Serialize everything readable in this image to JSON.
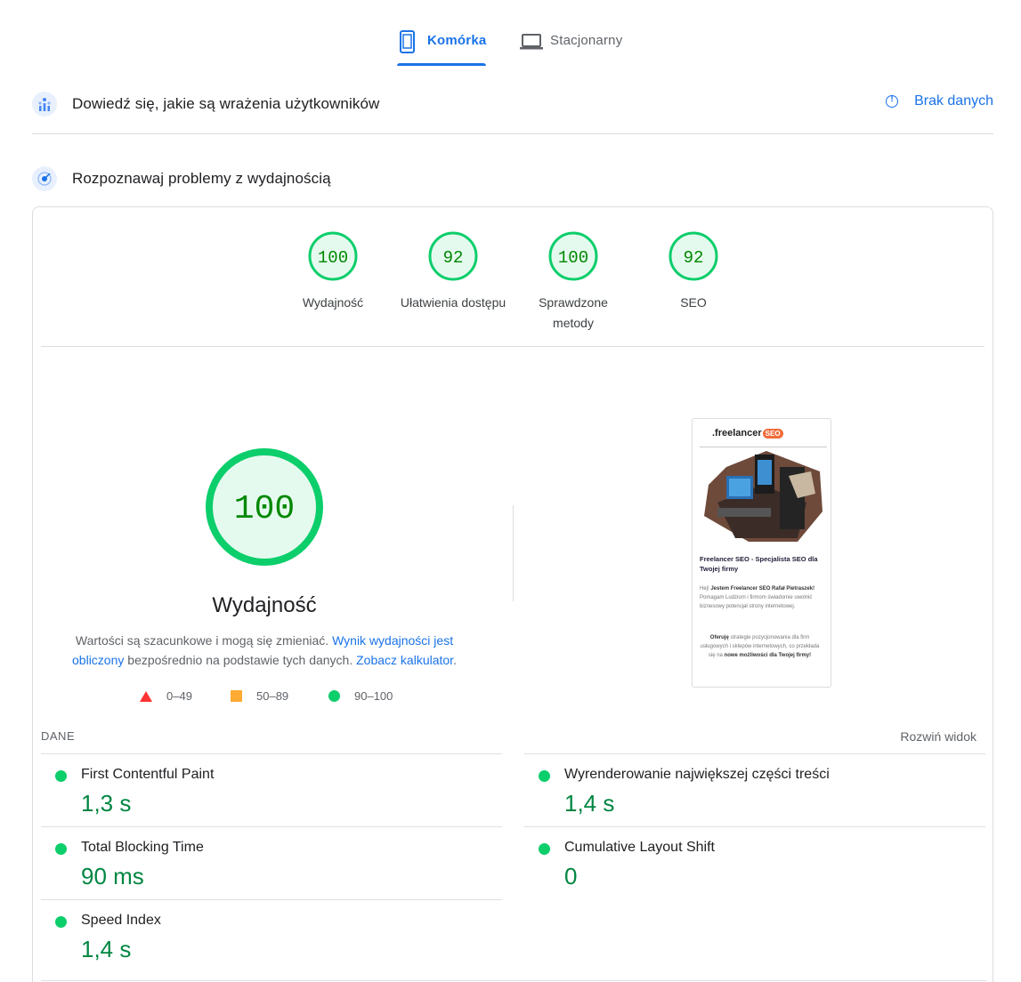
{
  "tabs": [
    {
      "label": "Komórka",
      "icon": "smartphone-icon",
      "active": true
    },
    {
      "label": "Stacjonarny",
      "icon": "laptop-icon",
      "active": false
    }
  ],
  "crux": {
    "title": "Dowiedź się, jakie są wrażenia użytkowników",
    "no_data_label": "Brak danych"
  },
  "lighthouse": {
    "title": "Rozpoznawaj problemy z wydajnością"
  },
  "gauges": [
    {
      "score": "100",
      "label_line1": "Wydajność",
      "label_line2": ""
    },
    {
      "score": "92",
      "label_line1": "Ułatwienia dostępu",
      "label_line2": ""
    },
    {
      "score": "100",
      "label_line1": "Sprawdzone",
      "label_line2": "metody"
    },
    {
      "score": "92",
      "label_line1": "SEO",
      "label_line2": ""
    }
  ],
  "performance": {
    "score": "100",
    "title": "Wydajność",
    "desc_part1": "Wartości są szacunkowe i mogą się zmieniać. ",
    "desc_link1": "Wynik wydajności jest obliczony",
    "desc_part2": " bezpośrednio na podstawie tych danych. ",
    "desc_link2": "Zobacz kalkulator",
    "desc_part3": "."
  },
  "legend": {
    "red": "0–49",
    "orange": "50–89",
    "green": "90–100"
  },
  "thumbnail": {
    "logo_text": ".freelancer",
    "logo_badge": "SEO",
    "heading": "Freelancer SEO - Specjalista SEO dla Twojej firmy",
    "p1_a": "Hej! ",
    "p1_b": "Jestem Freelancer SEO Rafał Pietraszek!",
    "p1_c": " Pomagam Ludziom i firmom świadomie uwolnić biznesowy potencjał strony internetowej.",
    "p2_a": "Oferuję",
    "p2_b": " strategie pozycjonowania dla firm usługowych i sklepów internetowych, co przekłada się na ",
    "p2_c": "nowe możliwości dla Twojej firmy!"
  },
  "metrics_section": {
    "label": "DANE",
    "expand_label": "Rozwiń widok"
  },
  "metrics": [
    {
      "name": "First Contentful Paint",
      "value": "1,3 s"
    },
    {
      "name": "Wyrenderowanie największej części treści",
      "value": "1,4 s"
    },
    {
      "name": "Total Blocking Time",
      "value": "90 ms"
    },
    {
      "name": "Cumulative Layout Shift",
      "value": "0"
    },
    {
      "name": "Speed Index",
      "value": "1,4 s"
    }
  ],
  "colors": {
    "accent": "#1a73e8",
    "pass": "#0cce6b",
    "pass_text": "#008800",
    "pass_fill": "#e5faef",
    "average": "#ffaa33",
    "fail": "#ff3333"
  }
}
